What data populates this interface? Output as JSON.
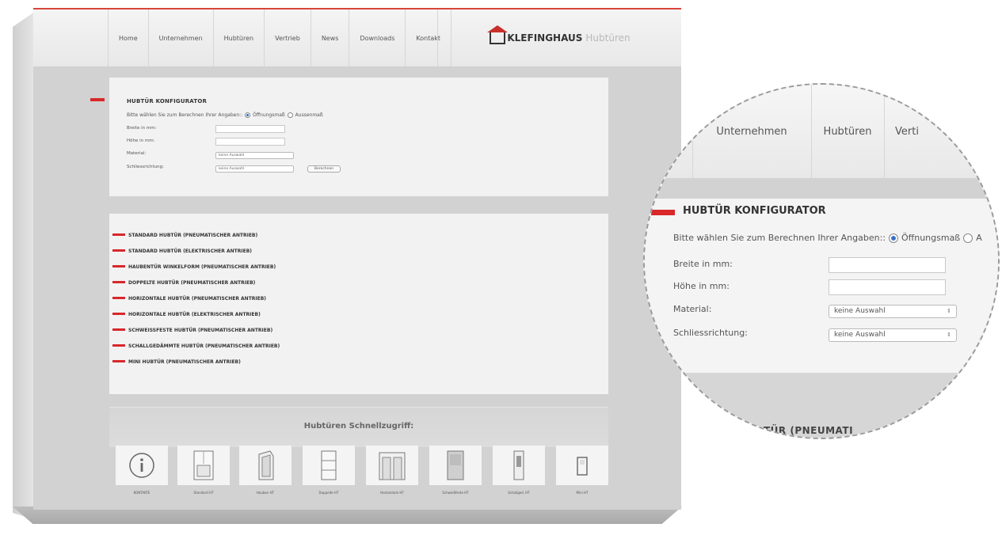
{
  "nav": {
    "items": [
      "Home",
      "Unternehmen",
      "Hubtüren",
      "Vertrieb",
      "News",
      "Downloads",
      "Kontakt"
    ],
    "logo_brand": "KLEFINGHAUS",
    "logo_sub": "Hubtüren"
  },
  "configurator": {
    "title": "HUBTÜR KONFIGURATOR",
    "prompt": "Bitte wählen Sie zum Berechnen Ihrer Angaben::",
    "option_opening": "Öffnungsmaß",
    "option_outer": "Aussenmaß",
    "selected_option": "Öffnungsmaß",
    "width_label": "Breite in mm:",
    "width_value": "",
    "height_label": "Höhe in mm:",
    "height_value": "",
    "material_label": "Material:",
    "material_value": "keine Auswahl",
    "closing_label": "Schliessrichtung:",
    "closing_value": "keine Auswahl",
    "calculate_label": "Berechnen"
  },
  "products": [
    "STANDARD HUBTÜR (PNEUMATISCHER ANTRIEB)",
    "STANDARD HUBTÜR (ELEKTRISCHER ANTRIEB)",
    "HAUBENTÜR WINKELFORM (PNEUMATISCHER ANTRIEB)",
    "DOPPELTE HUBTÜR (PNEUMATISCHER ANTRIEB)",
    "HORIZONTALE HUBTÜR (PNEUMATISCHER ANTRIEB)",
    "HORIZONTALE HUBTÜR (ELEKTRISCHER ANTRIEB)",
    "SCHWEISSFESTE HUBTÜR (PNEUMATISCHER ANTRIEB)",
    "SCHALLGEDÄMMTE HUBTÜR (PNEUMATISCHER ANTRIEB)",
    "MINI HUBTÜR (PNEUMATISCHER ANTRIEB)"
  ],
  "quick": {
    "title": "Hubtüren Schnellzugriff:",
    "tiles": [
      {
        "label": "KONTAKTE",
        "icon": "info-icon"
      },
      {
        "label": "Standard HT",
        "icon": "standard-door-icon"
      },
      {
        "label": "Hauben HT",
        "icon": "hood-door-icon"
      },
      {
        "label": "Doppelte HT",
        "icon": "double-door-icon"
      },
      {
        "label": "Horizontale HT",
        "icon": "horizontal-door-icon"
      },
      {
        "label": "Schweißfeste HT",
        "icon": "weldproof-door-icon"
      },
      {
        "label": "Schallged. HT",
        "icon": "soundproof-door-icon"
      },
      {
        "label": "Mini HT",
        "icon": "mini-door-icon"
      }
    ]
  },
  "lens": {
    "nav_items": [
      "Unternehmen",
      "Hubtüren",
      "Verti"
    ],
    "title": "HUBTÜR KONFIGURATOR",
    "prompt": "Bitte wählen Sie zum Berechnen Ihrer Angaben::",
    "option_opening": "Öffnungsmaß",
    "option_outer": "A",
    "width_label": "Breite in mm:",
    "height_label": "Höhe in mm:",
    "material_label": "Material:",
    "material_value": "keine Auswahl",
    "closing_label": "Schliessrichtung:",
    "closing_value": "keine Auswahl",
    "peek_text": "TÜR (PNEUMATI"
  },
  "colors": {
    "accent": "#d8282a",
    "radio_selected": "#3a6fc6",
    "page_bg": "#d2d2d2"
  }
}
